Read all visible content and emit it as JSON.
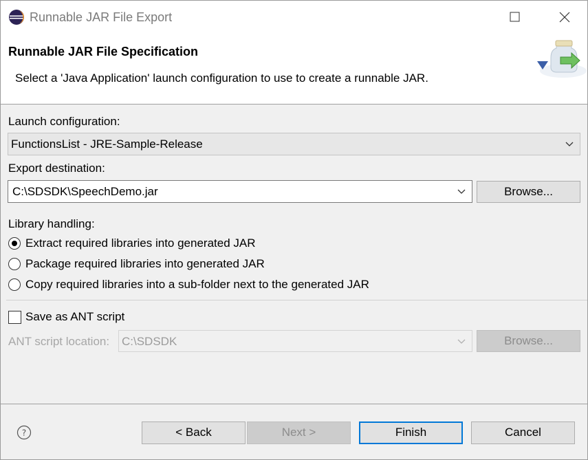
{
  "window": {
    "title": "Runnable JAR File Export"
  },
  "header": {
    "title": "Runnable JAR File Specification",
    "message": "Select a 'Java Application' launch configuration to use to create a runnable JAR."
  },
  "launch": {
    "label": "Launch configuration:",
    "value": "FunctionsList - JRE-Sample-Release"
  },
  "export": {
    "label": "Export destination:",
    "value": "C:\\SDSDK\\SpeechDemo.jar",
    "browse": "Browse..."
  },
  "library": {
    "label": "Library handling:",
    "options": [
      {
        "label": "Extract required libraries into generated JAR",
        "checked": true
      },
      {
        "label": "Package required libraries into generated JAR",
        "checked": false
      },
      {
        "label": "Copy required libraries into a sub-folder next to the generated JAR",
        "checked": false
      }
    ]
  },
  "ant": {
    "checkbox_label": "Save as ANT script",
    "checked": false,
    "location_label": "ANT script location:",
    "location_value": "C:\\SDSDK",
    "browse": "Browse..."
  },
  "footer": {
    "back": "< Back",
    "next": "Next >",
    "finish": "Finish",
    "cancel": "Cancel",
    "help_icon": "help-icon"
  },
  "colors": {
    "accent": "#0078d7",
    "dialog_bg": "#f0f0f0"
  }
}
